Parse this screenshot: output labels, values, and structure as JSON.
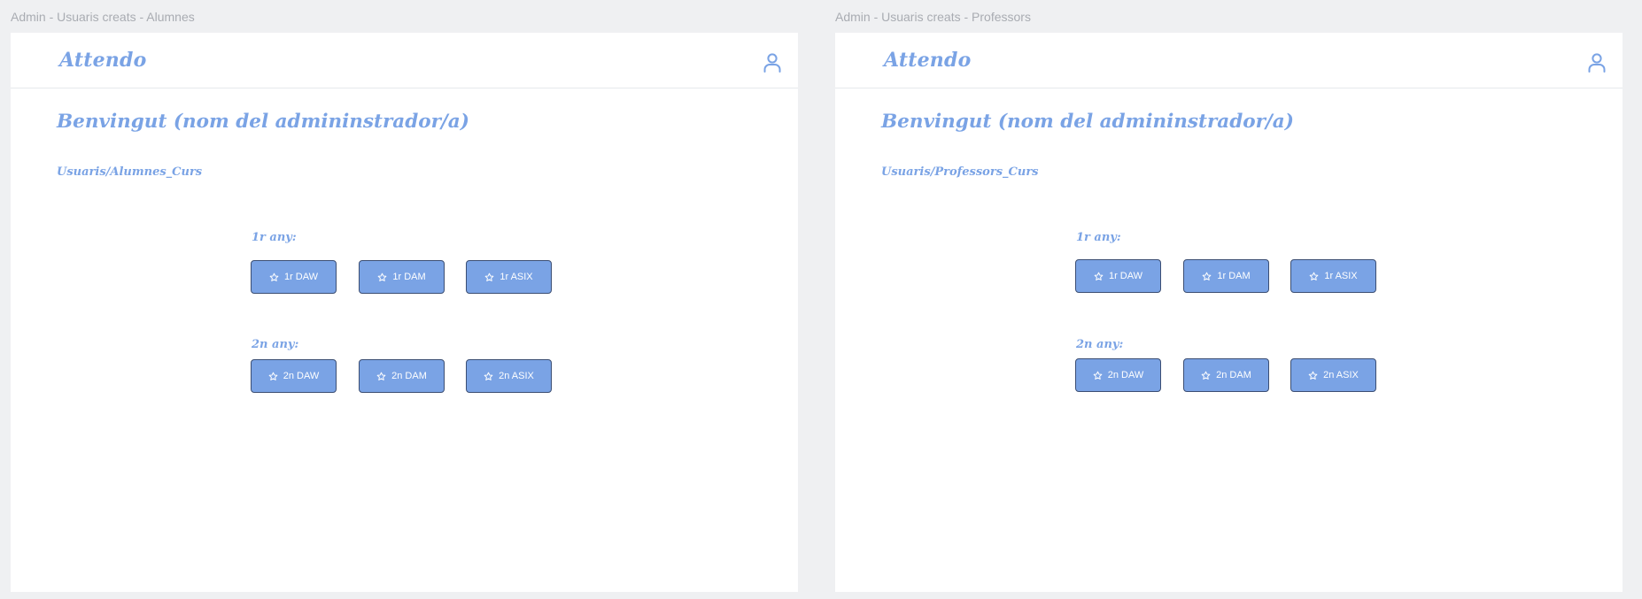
{
  "frames": [
    {
      "frame_label": "Admin - Usuaris creats - Alumnes",
      "brand": "Attendo",
      "user_icon": "user-icon",
      "welcome": "Benvingut (nom del admininstrador/a)",
      "breadcrumb": "Usuaris/Alumnes_Curs",
      "first_year": {
        "label": "1r any:",
        "courses": [
          "1r DAW",
          "1r DAM",
          "1r ASIX"
        ]
      },
      "second_year": {
        "label": "2n any:",
        "courses": [
          "2n DAW",
          "2n DAM",
          "2n ASIX"
        ]
      }
    },
    {
      "frame_label": "Admin - Usuaris creats - Professors",
      "brand": "Attendo",
      "user_icon": "user-icon",
      "welcome": "Benvingut (nom del admininstrador/a)",
      "breadcrumb": "Usuaris/Professors_Curs",
      "first_year": {
        "label": "1r any:",
        "courses": [
          "1r DAW",
          "1r DAM",
          "1r ASIX"
        ]
      },
      "second_year": {
        "label": "2n any:",
        "courses": [
          "2n DAW",
          "2n DAM",
          "2n ASIX"
        ]
      }
    }
  ],
  "colors": {
    "background": "#eff0f2",
    "accent": "#7aa3e5",
    "button_border": "#3b4e73",
    "frame_label": "#a9acb2"
  },
  "button_icon": "star-icon"
}
